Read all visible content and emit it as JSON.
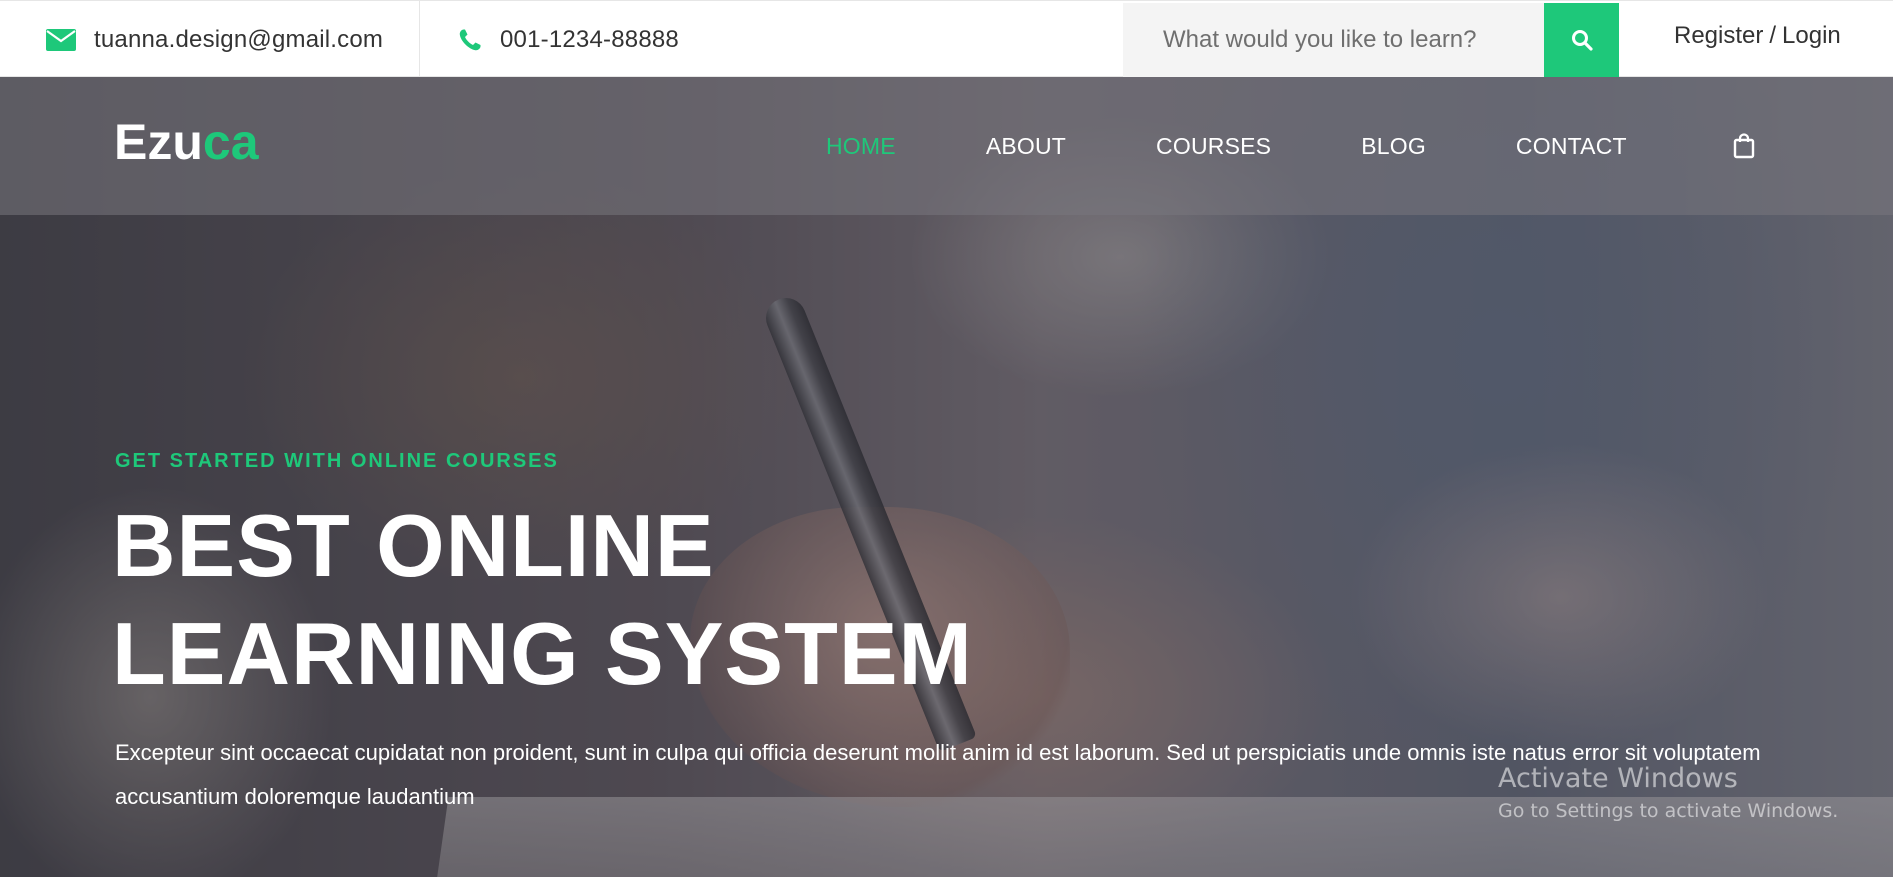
{
  "topbar": {
    "email": "tuanna.design@gmail.com",
    "phone": "001-1234-88888",
    "search_placeholder": "What would you like to learn?",
    "register_label": "Register",
    "separator": "/",
    "login_label": "Login"
  },
  "brand": {
    "logo_part1": "Ezu",
    "logo_part2": "ca",
    "accent_color": "#1ec87a"
  },
  "nav": {
    "items": [
      {
        "label": "HOME",
        "active": true
      },
      {
        "label": "ABOUT",
        "active": false
      },
      {
        "label": "COURSES",
        "active": false
      },
      {
        "label": "BLOG",
        "active": false
      },
      {
        "label": "CONTACT",
        "active": false
      }
    ],
    "cart_icon": "shopping-bag-icon"
  },
  "hero": {
    "kicker": "GET STARTED WITH ONLINE COURSES",
    "title_line1": "BEST ONLINE",
    "title_line2": "LEARNING SYSTEM",
    "description": "Excepteur sint occaecat cupidatat non proident, sunt in culpa qui officia deserunt mollit anim id est laborum. Sed ut perspiciatis unde omnis iste natus error sit voluptatem accusantium doloremque laudantium"
  },
  "watermark": {
    "line1": "Activate Windows",
    "line2": "Go to Settings to activate Windows."
  },
  "icons": {
    "email": "envelope-icon",
    "phone": "phone-icon",
    "search": "search-icon"
  }
}
